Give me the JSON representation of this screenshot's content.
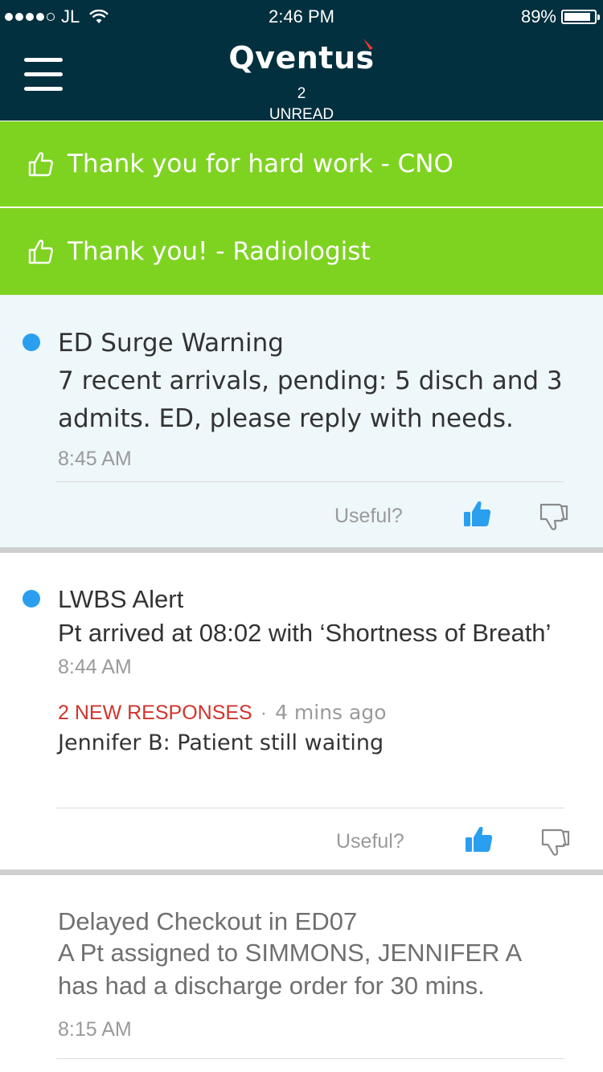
{
  "status_bar": {
    "carrier": "JL",
    "time": "2:46 PM",
    "battery": "89%",
    "battery_level": 0.89
  },
  "header": {
    "logo": "Qventus",
    "unread_count": "2",
    "unread_label": "UNREAD",
    "background": "#02303f"
  },
  "banners": [
    {
      "text": "Thank you for hard work - CNO",
      "icon": "thumbs-up-outline-icon"
    },
    {
      "text": "Thank you! - Radiologist",
      "icon": "thumbs-up-outline-icon"
    }
  ],
  "alerts": [
    {
      "title": "ED Surge Warning",
      "body": "7 recent arrivals, pending: 5 disch and 3 admits. ED, please reply with needs.",
      "time": "8:45 AM",
      "useful_label": "Useful?",
      "unread": true
    },
    {
      "title": "LWBS Alert",
      "body": "Pt arrived at 08:02 with ‘Shortness of Breath’",
      "time": "8:44 AM",
      "responses": "2 NEW RESPONSES",
      "responses_dot": "·",
      "responses_ago": "4 mins ago",
      "latest_response": "Jennifer B: Patient still waiting",
      "useful_label": "Useful?",
      "unread": true
    },
    {
      "title": "Delayed Checkout in ED07",
      "body": "A Pt assigned to SIMMONS, JENNIFER A has had a discharge order for 30 mins.",
      "time": "8:15 AM",
      "unread": false
    }
  ],
  "colors": {
    "accent_green": "#7ed321",
    "unread_dot": "#2a9ff0",
    "thumb_up": "#2a9ff0",
    "new_responses": "#d0342c"
  }
}
